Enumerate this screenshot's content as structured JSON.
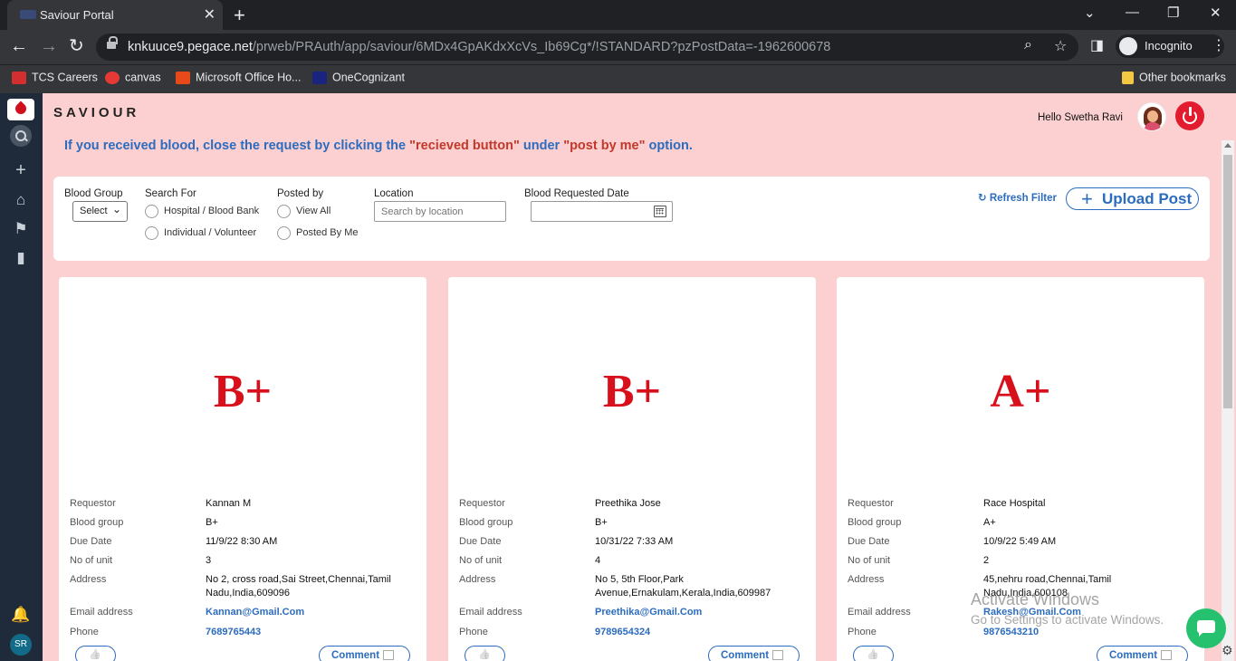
{
  "browser": {
    "tab_title": "Saviour Portal",
    "new_tab": "+",
    "close_tab": "✕",
    "url_host": "knkuuce9.pegace.net",
    "url_path": "/prweb/PRAuth/app/saviour/6MDx4GpAKdxXcVs_Ib69Cg*/!STANDARD?pzPostData=-1962600678",
    "incognito_label": "Incognito",
    "bookmarks": [
      {
        "label": "TCS Careers",
        "color": "#d32f2f"
      },
      {
        "label": "canvas",
        "color": "#e53935"
      },
      {
        "label": "Microsoft Office Ho...",
        "color": "#e64a19"
      },
      {
        "label": "OneCognizant",
        "color": "#1a237e"
      }
    ],
    "other_bookmarks": "Other bookmarks"
  },
  "app": {
    "brand": "SAVIOUR",
    "greeting": "Hello  Swetha Ravi",
    "user_initials": "SR",
    "notice": {
      "part1": "If you received blood, close the request by clicking the ",
      "part2": "\"recieved button\"",
      "part3": " under ",
      "part4": "\"post by me\"",
      "part5": " option."
    }
  },
  "filters": {
    "blood_group_label": "Blood Group",
    "blood_group_value": "Select",
    "search_for_label": "Search For",
    "search_for_options": [
      "Hospital / Blood Bank",
      "Individual / Volunteer"
    ],
    "posted_by_label": "Posted by",
    "posted_by_options": [
      "View All",
      "Posted By Me"
    ],
    "location_label": "Location",
    "location_placeholder": "Search by location",
    "date_label": "Blood Requested Date",
    "refresh_label": "Refresh Filter",
    "upload_label": "Upload Post"
  },
  "field_labels": {
    "requestor": "Requestor",
    "blood_group": "Blood group",
    "due_date": "Due Date",
    "units": "No of unit",
    "address": "Address",
    "email": "Email address",
    "phone": "Phone",
    "comment": "Comment"
  },
  "posts": [
    {
      "group": "B+",
      "requestor": "Kannan M",
      "blood_group": "B+",
      "due_date": "11/9/22 8:30 AM",
      "units": "3",
      "address": "No 2, cross road,Sai Street,Chennai,Tamil Nadu,India,609096",
      "email": "Kannan@Gmail.Com",
      "phone": "7689765443"
    },
    {
      "group": "B+",
      "requestor": "Preethika Jose",
      "blood_group": "B+",
      "due_date": "10/31/22 7:33 AM",
      "units": "4",
      "address": "No 5, 5th Floor,Park Avenue,Ernakulam,Kerala,India,609987",
      "email": "Preethika@Gmail.Com",
      "phone": "9789654324"
    },
    {
      "group": "A+",
      "requestor": "Race Hospital",
      "blood_group": "A+",
      "due_date": "10/9/22 5:49 AM",
      "units": "2",
      "address": "45,nehru road,Chennai,Tamil Nadu,India,600108",
      "email": "Rakesh@Gmail.Com",
      "phone": "9876543210"
    }
  ],
  "watermark": {
    "line1": "Activate Windows",
    "line2": "Go to Settings to activate Windows."
  }
}
